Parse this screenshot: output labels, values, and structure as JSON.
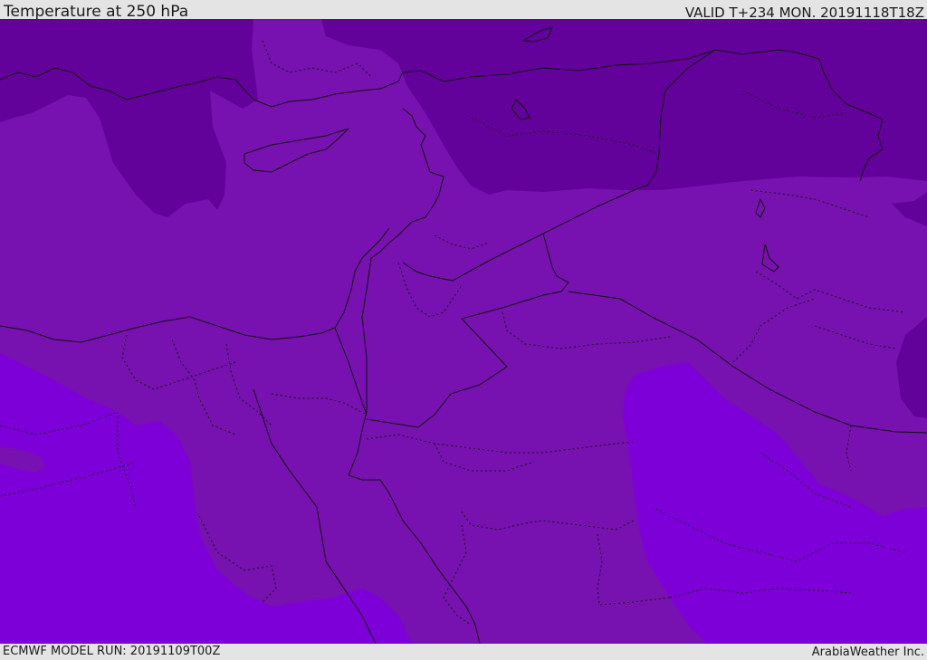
{
  "header": {
    "title": "Temperature at 250 hPa",
    "valid": "VALID T+234 MON. 20191118T18Z"
  },
  "footer": {
    "model_run": "ECMWF MODEL RUN: 20191109T00Z",
    "credit": "ArabiaWeather Inc."
  },
  "map": {
    "parameter": "Temperature",
    "level": "250 hPa",
    "colors": {
      "cold_band": "#63019b",
      "mid_band": "#7711b0",
      "warm_band": "#7e00d8",
      "border_line": "#111111"
    }
  }
}
